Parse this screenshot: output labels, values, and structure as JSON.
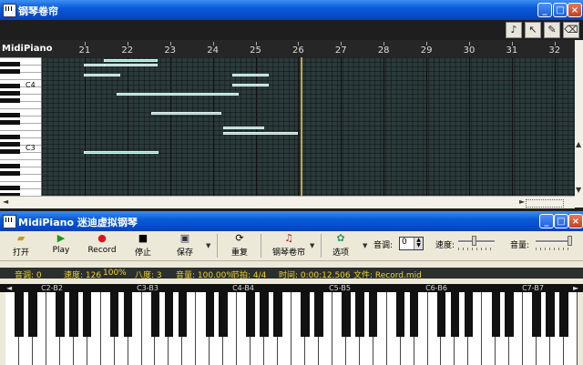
{
  "roll_window": {
    "title": "钢琴卷帘",
    "brand": "MidiPiano",
    "tools": [
      "speaker-icon",
      "pointer-icon",
      "pencil-icon",
      "eraser-icon"
    ],
    "ruler": [
      "21",
      "22",
      "23",
      "24",
      "25",
      "26",
      "27",
      "28",
      "29",
      "30",
      "31",
      "32"
    ],
    "key_labels": [
      "C4",
      "C3"
    ],
    "notes": [
      {
        "bar": 20.98,
        "len": 0.55,
        "row": 1
      },
      {
        "bar": 21.45,
        "len": 1.25,
        "row": 0
      },
      {
        "bar": 21.45,
        "len": 1.25,
        "row": 1
      },
      {
        "bar": 20.98,
        "len": 0.85,
        "row": 3
      },
      {
        "bar": 24.45,
        "len": 0.85,
        "row": 3
      },
      {
        "bar": 24.45,
        "len": 0.85,
        "row": 5
      },
      {
        "bar": 21.75,
        "len": 2.85,
        "row": 7
      },
      {
        "bar": 22.55,
        "len": 1.65,
        "row": 11
      },
      {
        "bar": 24.25,
        "len": 0.95,
        "row": 14
      },
      {
        "bar": 24.25,
        "len": 1.75,
        "row": 15
      },
      {
        "bar": 20.98,
        "len": 1.75,
        "row": 19
      }
    ],
    "playhead_bar": 26.05
  },
  "piano_window": {
    "title": "MidiPiano 迷迪虚拟钢琴",
    "toolbar": {
      "open": "打开",
      "play": "Play",
      "record": "Record",
      "stop": "停止",
      "save": "保存",
      "reset": "重复",
      "roll": "钢琴卷帘",
      "options": "选项",
      "pitch_label": "音调:",
      "pitch_value": "0",
      "speed_label": "速度:",
      "volume_label": "音量:"
    },
    "status": {
      "pitch": "音调: 0",
      "speed": "速度: 126",
      "speed_pct": "100%",
      "octave": "八度: 3",
      "volume": "音量: 100.00%",
      "beat": "节拍: 4/4",
      "time": "时间: 0:00:12.506",
      "file": "文件: Record.mid"
    },
    "octaves": [
      "C2-B2",
      "C3-B3",
      "C4-B4",
      "C5-B5",
      "C6-B6",
      "C7-B7"
    ]
  }
}
